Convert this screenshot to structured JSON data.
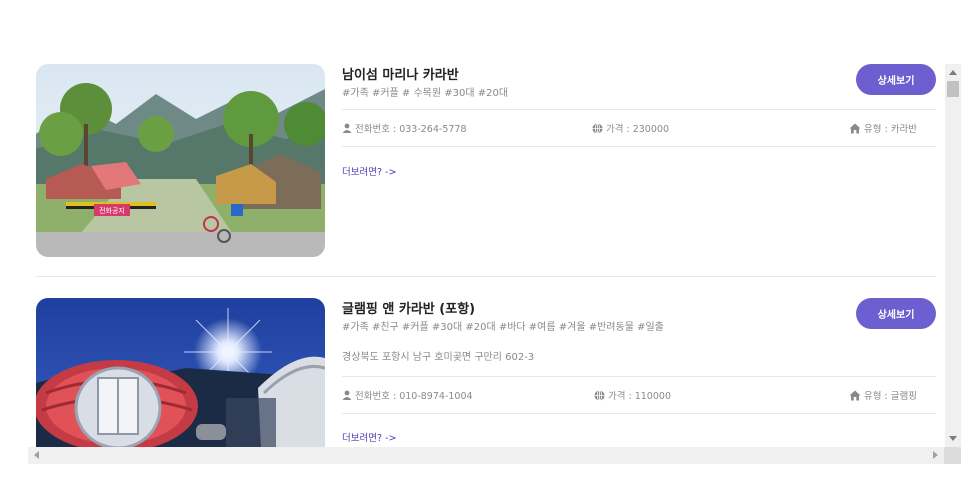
{
  "listings": [
    {
      "title": "남이섬 마리나 카라반",
      "tags": "#가족 #커플 # 수목원 #30대 #20대",
      "button": "상세보기",
      "phone": "전화번호 : 033-264-5778",
      "price": "가격 : 230000",
      "type": "유형 : 카라반",
      "more": "더보려면? ->",
      "sign_text": "전화공지",
      "image": "campground-photo"
    },
    {
      "title": "글램핑 앤 카라반 (포항)",
      "tags": "#가족 #친구 #커플 #30대 #20대 #바다 #여름 #겨울 #반려동물 #일출",
      "address": "경상북도 포항시 남구 호미곶면 구만리 602-3",
      "button": "상세보기",
      "phone": "전화번호 : 010-8974-1004",
      "price": "가격 : 110000",
      "type": "유형 : 글램핑",
      "more": "더보려면? ->",
      "image": "glamping-pod-night-photo"
    }
  ],
  "icons": {
    "phone": "user-icon",
    "price": "globe-icon",
    "type": "home-icon"
  },
  "colors": {
    "accent": "#6d5fd0",
    "link": "#4a3fb0",
    "muted": "#8a8a8a"
  }
}
